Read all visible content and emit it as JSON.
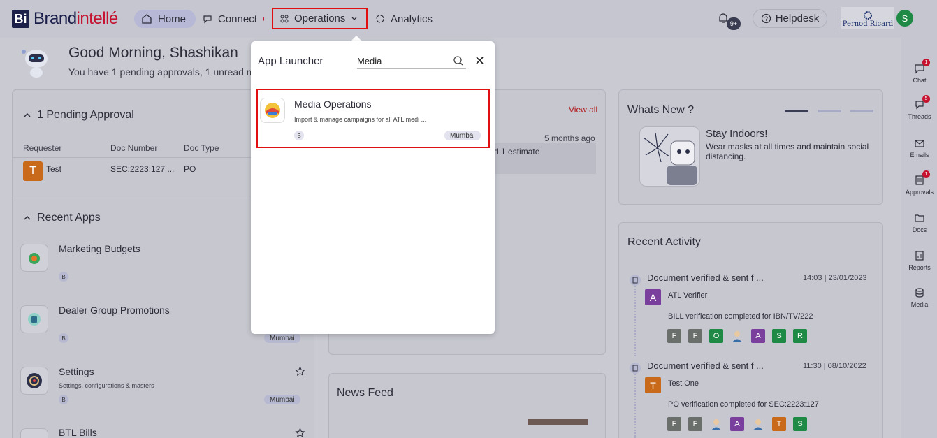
{
  "brand": {
    "abbr": "Bi",
    "name_a": "Brand",
    "name_b": "intellé"
  },
  "nav": {
    "home": "Home",
    "connect": "Connect",
    "operations": "Operations",
    "analytics": "Analytics"
  },
  "header": {
    "helpdesk": "Helpdesk",
    "notif_badge": "9+",
    "client": "Pernod Ricard",
    "user_initial": "S"
  },
  "greeting": {
    "title": "Good Morning, Shashikan",
    "subtitle": "You have 1 pending approvals, 1 unread me"
  },
  "pending": {
    "title": "1 Pending Approval",
    "columns": [
      "Requester",
      "Doc Number",
      "Doc Type"
    ],
    "rows": [
      {
        "initial": "T",
        "requester": "Test",
        "doc_number": "SEC:2223:127 ...",
        "doc_type": "PO"
      }
    ]
  },
  "recent_apps": {
    "title": "Recent Apps",
    "items": [
      {
        "name": "Marketing Budgets",
        "desc": "",
        "chip": "B",
        "loc": ""
      },
      {
        "name": "Dealer Group Promotions",
        "desc": "",
        "chip": "B",
        "loc": "Mumbai"
      },
      {
        "name": "Settings",
        "desc": "Settings, configurations & masters",
        "chip": "B",
        "loc": "Mumbai"
      },
      {
        "name": "BTL Bills",
        "desc": "",
        "chip": "",
        "loc": ""
      }
    ]
  },
  "mid": {
    "view_all": "View all",
    "time": "5 months ago",
    "snippet": "d 1 estimate"
  },
  "news": {
    "title": "News Feed"
  },
  "whats_new": {
    "title": "Whats New ?",
    "headline": "Stay Indoors!",
    "body": "Wear masks at all times and maintain social distancing."
  },
  "activity": {
    "title": "Recent Activity",
    "items": [
      {
        "title": "Document verified & sent f ...",
        "time": "14:03 | 23/01/2023",
        "user_initial": "A",
        "user": "ATL Verifier",
        "user_color": "#7a3e9d",
        "desc": "BILL verification completed for IBN/TV/222",
        "avatars": [
          {
            "l": "F",
            "c": "#6b6f6b"
          },
          {
            "l": "F",
            "c": "#6b6f6b"
          },
          {
            "l": "O",
            "c": "#1e8a45"
          },
          {
            "l": "",
            "c": "person"
          },
          {
            "l": "A",
            "c": "#7a3e9d"
          },
          {
            "l": "S",
            "c": "#1e8a45"
          },
          {
            "l": "R",
            "c": "#1e8a45"
          }
        ]
      },
      {
        "title": "Document verified & sent f ...",
        "time": "11:30 | 08/10/2022",
        "user_initial": "T",
        "user": "Test One",
        "user_color": "#c86a1a",
        "desc": "PO verification completed for SEC:2223:127",
        "avatars": [
          {
            "l": "F",
            "c": "#6b6f6b"
          },
          {
            "l": "F",
            "c": "#6b6f6b"
          },
          {
            "l": "",
            "c": "person"
          },
          {
            "l": "A",
            "c": "#7a3e9d"
          },
          {
            "l": "",
            "c": "person"
          },
          {
            "l": "T",
            "c": "#c86a1a"
          },
          {
            "l": "S",
            "c": "#1e8a45"
          }
        ]
      }
    ]
  },
  "rail": [
    {
      "label": "Chat",
      "badge": "1"
    },
    {
      "label": "Threads",
      "badge": "5"
    },
    {
      "label": "Emails",
      "badge": ""
    },
    {
      "label": "Approvals",
      "badge": "1"
    },
    {
      "label": "Docs",
      "badge": ""
    },
    {
      "label": "Reports",
      "badge": ""
    },
    {
      "label": "Media",
      "badge": ""
    }
  ],
  "launcher": {
    "title": "App Launcher",
    "search_value": "Media",
    "result": {
      "name": "Media Operations",
      "desc": "Import & manage campaigns for all ATL medi ...",
      "chip": "B",
      "loc": "Mumbai"
    }
  }
}
